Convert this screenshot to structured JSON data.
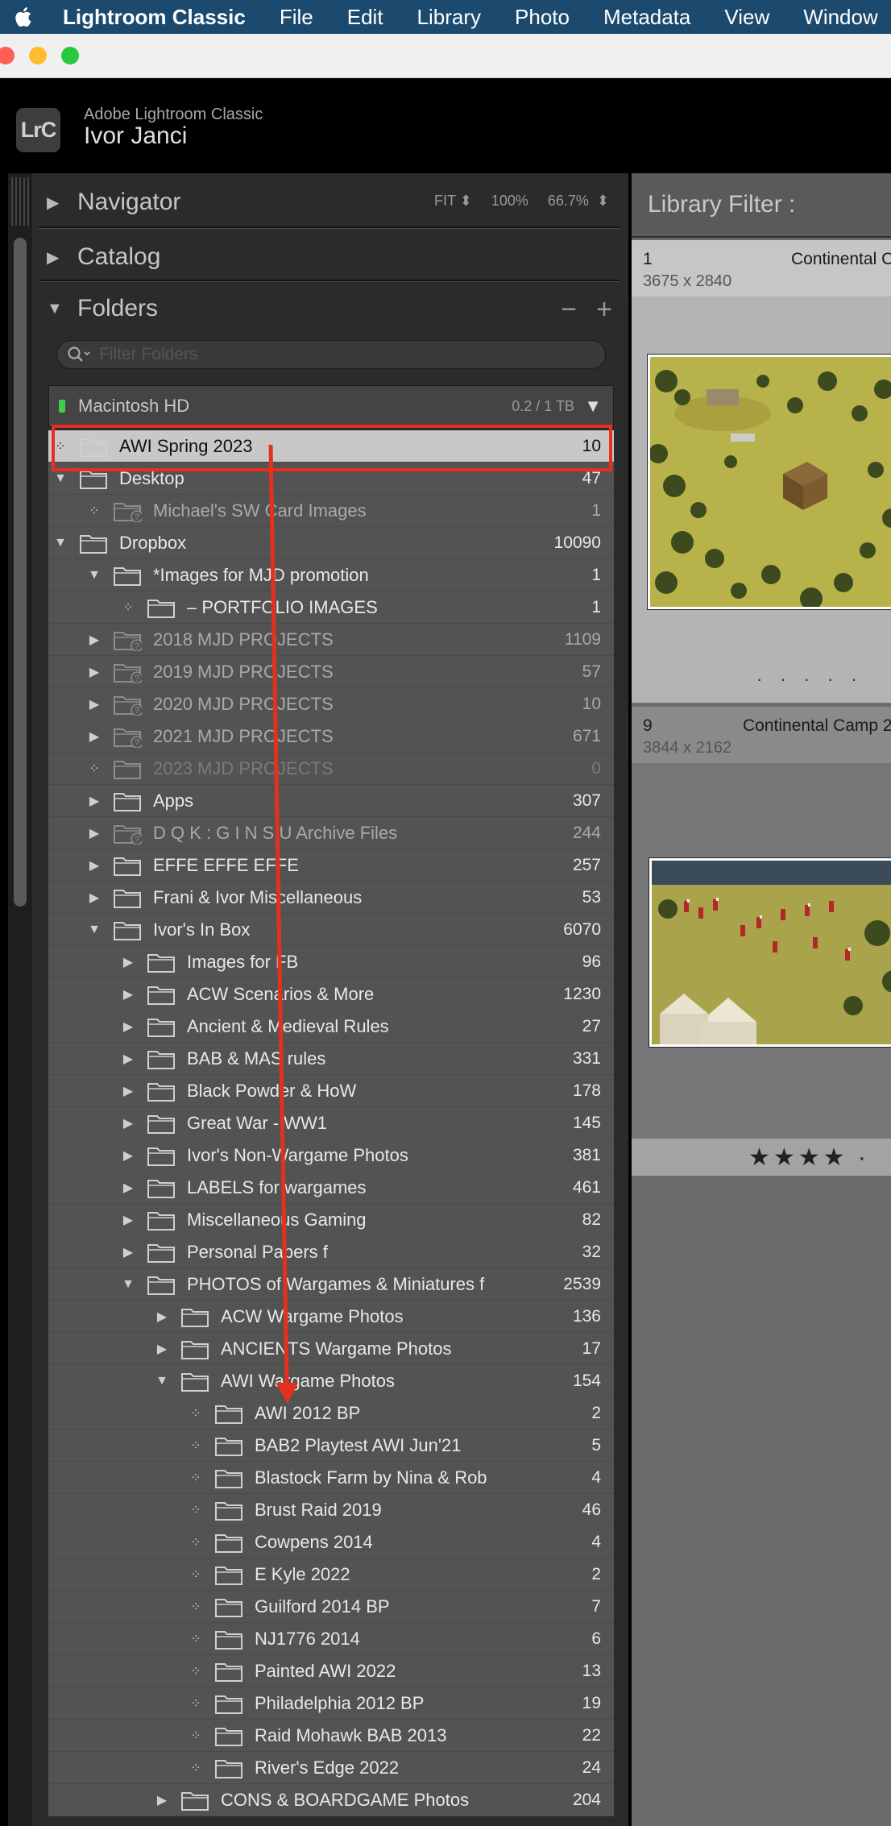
{
  "menubar": {
    "app": "Lightroom Classic",
    "items": [
      "File",
      "Edit",
      "Library",
      "Photo",
      "Metadata",
      "View",
      "Window"
    ],
    "bg_color": "#1c4a6e"
  },
  "identity": {
    "logo": "LrC",
    "subtitle": "Adobe Lightroom Classic",
    "user": "Ivor Janci"
  },
  "navigator": {
    "title": "Navigator",
    "zoom": [
      "FIT",
      "100%",
      "66.7%"
    ]
  },
  "catalog": {
    "title": "Catalog"
  },
  "folders": {
    "title": "Folders",
    "minus": "−",
    "plus": "+",
    "filter_placeholder": "Filter Folders",
    "volume": {
      "name": "Macintosh HD",
      "size": "0.2 / 1 TB"
    },
    "rows": [
      {
        "label": "AWI Spring 2023",
        "count": "10",
        "indent": 0,
        "exp": "dot",
        "state": "selected"
      },
      {
        "label": "Desktop",
        "count": "47",
        "indent": 0,
        "exp": "down",
        "state": "normal"
      },
      {
        "label": "Michael's SW Card Images",
        "count": "1",
        "indent": 1,
        "exp": "dot",
        "state": "missing"
      },
      {
        "label": "Dropbox",
        "count": "10090",
        "indent": 0,
        "exp": "down",
        "state": "normal"
      },
      {
        "label": "*Images for MJD promotion",
        "count": "1",
        "indent": 1,
        "exp": "down",
        "state": "normal"
      },
      {
        "label": "– PORTFOLIO IMAGES",
        "count": "1",
        "indent": 2,
        "exp": "dot",
        "state": "normal"
      },
      {
        "label": "2018 MJD PROJECTS",
        "count": "1109",
        "indent": 1,
        "exp": "right",
        "state": "missing"
      },
      {
        "label": "2019 MJD PROJECTS",
        "count": "57",
        "indent": 1,
        "exp": "right",
        "state": "missing"
      },
      {
        "label": "2020 MJD PROJECTS",
        "count": "10",
        "indent": 1,
        "exp": "right",
        "state": "missing"
      },
      {
        "label": "2021 MJD PROJECTS",
        "count": "671",
        "indent": 1,
        "exp": "right",
        "state": "missing"
      },
      {
        "label": "2023 MJD PROJECTS",
        "count": "0",
        "indent": 1,
        "exp": "dot",
        "state": "faint"
      },
      {
        "label": "Apps",
        "count": "307",
        "indent": 1,
        "exp": "right",
        "state": "normal"
      },
      {
        "label": "D Q K : G I N S U  Archive Files",
        "count": "244",
        "indent": 1,
        "exp": "right",
        "state": "missing"
      },
      {
        "label": "EFFE EFFE EFFE",
        "count": "257",
        "indent": 1,
        "exp": "right",
        "state": "normal"
      },
      {
        "label": "Frani & Ivor Miscellaneous",
        "count": "53",
        "indent": 1,
        "exp": "right",
        "state": "normal"
      },
      {
        "label": "Ivor's In Box",
        "count": "6070",
        "indent": 1,
        "exp": "down",
        "state": "normal"
      },
      {
        "label": " Images for FB",
        "count": "96",
        "indent": 2,
        "exp": "right",
        "state": "normal"
      },
      {
        "label": "ACW Scenarios & More",
        "count": "1230",
        "indent": 2,
        "exp": "right",
        "state": "normal"
      },
      {
        "label": "Ancient & Medieval Rules",
        "count": "27",
        "indent": 2,
        "exp": "right",
        "state": "normal"
      },
      {
        "label": "BAB & MAS rules",
        "count": "331",
        "indent": 2,
        "exp": "right",
        "state": "normal"
      },
      {
        "label": "Black Powder & HoW",
        "count": "178",
        "indent": 2,
        "exp": "right",
        "state": "normal"
      },
      {
        "label": "Great War - WW1",
        "count": "145",
        "indent": 2,
        "exp": "right",
        "state": "normal"
      },
      {
        "label": "Ivor's Non-Wargame Photos",
        "count": "381",
        "indent": 2,
        "exp": "right",
        "state": "normal"
      },
      {
        "label": "LABELS for wargames",
        "count": "461",
        "indent": 2,
        "exp": "right",
        "state": "normal"
      },
      {
        "label": "Miscellaneous Gaming",
        "count": "82",
        "indent": 2,
        "exp": "right",
        "state": "normal"
      },
      {
        "label": "Personal Papers f",
        "count": "32",
        "indent": 2,
        "exp": "right",
        "state": "normal"
      },
      {
        "label": "PHOTOS of Wargames & Miniatures f",
        "count": "2539",
        "indent": 2,
        "exp": "down",
        "state": "normal"
      },
      {
        "label": "ACW Wargame Photos",
        "count": "136",
        "indent": 3,
        "exp": "right",
        "state": "normal"
      },
      {
        "label": "ANCIENTS Wargame Photos",
        "count": "17",
        "indent": 3,
        "exp": "right",
        "state": "normal"
      },
      {
        "label": "AWI Wargame Photos",
        "count": "154",
        "indent": 3,
        "exp": "down",
        "state": "normal"
      },
      {
        "label": "AWI 2012 BP",
        "count": "2",
        "indent": 4,
        "exp": "dot",
        "state": "normal"
      },
      {
        "label": "BAB2 Playtest AWI Jun'21",
        "count": "5",
        "indent": 4,
        "exp": "dot",
        "state": "normal"
      },
      {
        "label": "Blastock Farm by Nina & Rob",
        "count": "4",
        "indent": 4,
        "exp": "dot",
        "state": "normal"
      },
      {
        "label": "Brust Raid 2019",
        "count": "46",
        "indent": 4,
        "exp": "dot",
        "state": "normal"
      },
      {
        "label": "Cowpens 2014",
        "count": "4",
        "indent": 4,
        "exp": "dot",
        "state": "normal"
      },
      {
        "label": "E Kyle 2022",
        "count": "2",
        "indent": 4,
        "exp": "dot",
        "state": "normal"
      },
      {
        "label": "Guilford 2014 BP",
        "count": "7",
        "indent": 4,
        "exp": "dot",
        "state": "normal"
      },
      {
        "label": "NJ1776 2014",
        "count": "6",
        "indent": 4,
        "exp": "dot",
        "state": "normal"
      },
      {
        "label": "Painted AWI 2022",
        "count": "13",
        "indent": 4,
        "exp": "dot",
        "state": "normal"
      },
      {
        "label": "Philadelphia 2012 BP",
        "count": "19",
        "indent": 4,
        "exp": "dot",
        "state": "normal"
      },
      {
        "label": "Raid Mohawk BAB 2013",
        "count": "22",
        "indent": 4,
        "exp": "dot",
        "state": "normal"
      },
      {
        "label": "River's Edge 2022",
        "count": "24",
        "indent": 4,
        "exp": "dot",
        "state": "normal"
      },
      {
        "label": "CONS & BOARDGAME Photos",
        "count": "204",
        "indent": 3,
        "exp": "right",
        "state": "normal"
      }
    ]
  },
  "grid": {
    "filter_title": "Library Filter :",
    "cells": [
      {
        "index": "1",
        "dims": "3675 x 2840",
        "name": "Continental C"
      },
      {
        "index": "9",
        "dims": "3844 x 2162",
        "name": "Continental Camp 2"
      }
    ],
    "rating": "★★★★ ·"
  },
  "annotation": {
    "color": "#e5301e"
  }
}
